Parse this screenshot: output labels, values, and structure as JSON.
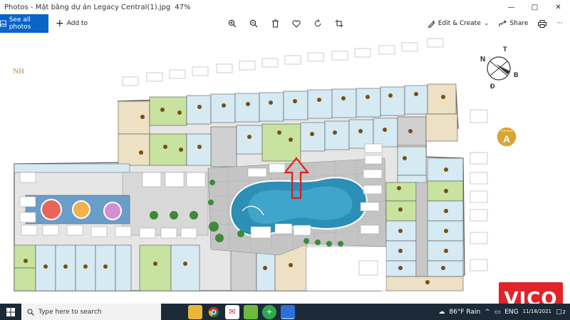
{
  "window": {
    "app": "Photos",
    "separator": " - ",
    "filename": "Mặt bằng dự án Legacy Central(1).jpg",
    "zoom": "47%",
    "minimize": "—",
    "maximize": "□",
    "close": "✕"
  },
  "toolbar": {
    "see_all": "See all photos",
    "add_to": "Add to",
    "edit_create": "Edit & Create",
    "share": "Share"
  },
  "plan": {
    "corner_text": "NH",
    "compass": {
      "n": "N",
      "t": "T",
      "b": "B",
      "d": "Đ"
    },
    "badge": {
      "top": "TÒA NHÀ",
      "letter": "A"
    }
  },
  "taskbar": {
    "search_placeholder": "Type here to search",
    "weather": "86°F  Rain",
    "lang": "ENG",
    "time": "",
    "date": "11/18/2021",
    "notif_count": "2"
  },
  "watermark": {
    "text": "VICO"
  },
  "colors": {
    "accent": "#0a64c8",
    "taskbar": "#1c2a38",
    "plaza": "#c4c4c4",
    "pool": "#2b8fb6",
    "green_unit": "#c7e39f",
    "blue_unit": "#d6eaf3",
    "beige_unit": "#ede0c4",
    "marker": "#e31b1b",
    "unit_dot": "#7a4f15",
    "watermark": "#e1232b"
  }
}
